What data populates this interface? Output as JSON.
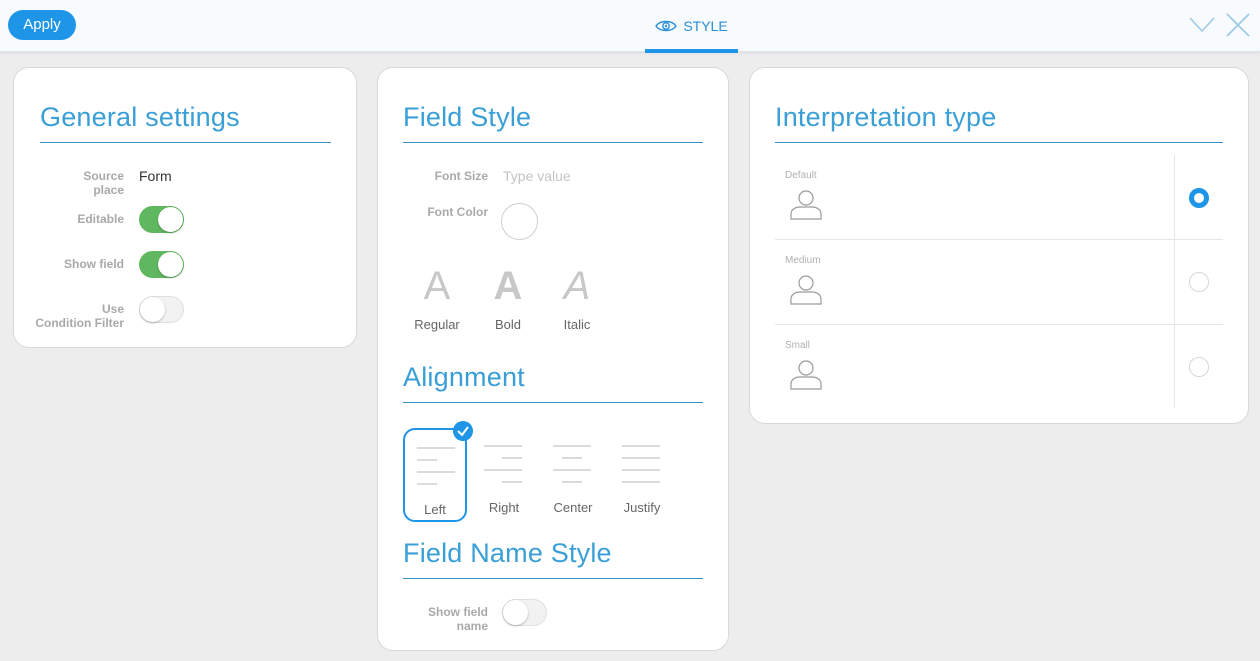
{
  "toolbar": {
    "apply_label": "Apply",
    "active_tab_label": "STYLE",
    "tab_icon": "eye-icon",
    "collapse_icon": "chevron-down-icon",
    "close_icon": "close-icon",
    "accent_color": "#1e95e6"
  },
  "general": {
    "title": "General settings",
    "source_place_label": "Source place",
    "source_place_value": "Form",
    "editable_label": "Editable",
    "editable_on": true,
    "show_field_label": "Show field",
    "show_field_on": true,
    "use_condition_filter_label_line1": "Use",
    "use_condition_filter_label_line2": "Condition Filter",
    "use_condition_filter_on": false
  },
  "field_style": {
    "title": "Field Style",
    "font_size_label": "Font Size",
    "font_size_placeholder": "Type value",
    "font_color_label": "Font Color",
    "font_styles": [
      {
        "glyph": "A",
        "label": "Regular"
      },
      {
        "glyph": "A",
        "label": "Bold"
      },
      {
        "glyph": "A",
        "label": "Italic"
      }
    ]
  },
  "alignment": {
    "title": "Alignment",
    "selected": "Left",
    "options": [
      {
        "label": "Left"
      },
      {
        "label": "Right"
      },
      {
        "label": "Center"
      },
      {
        "label": "Justify"
      }
    ]
  },
  "field_name_style": {
    "title": "Field Name Style",
    "show_field_name_label_line1": "Show field",
    "show_field_name_label_line2": "name",
    "show_field_name_on": false
  },
  "interpretation": {
    "title": "Interpretation type",
    "selected": "Default",
    "options": [
      {
        "label": "Default",
        "icon": "person-icon"
      },
      {
        "label": "Medium",
        "icon": "person-icon"
      },
      {
        "label": "Small",
        "icon": "person-icon"
      }
    ]
  },
  "colors": {
    "toggle_on": "#5fb85f",
    "title_blue": "#3a9fd6"
  }
}
